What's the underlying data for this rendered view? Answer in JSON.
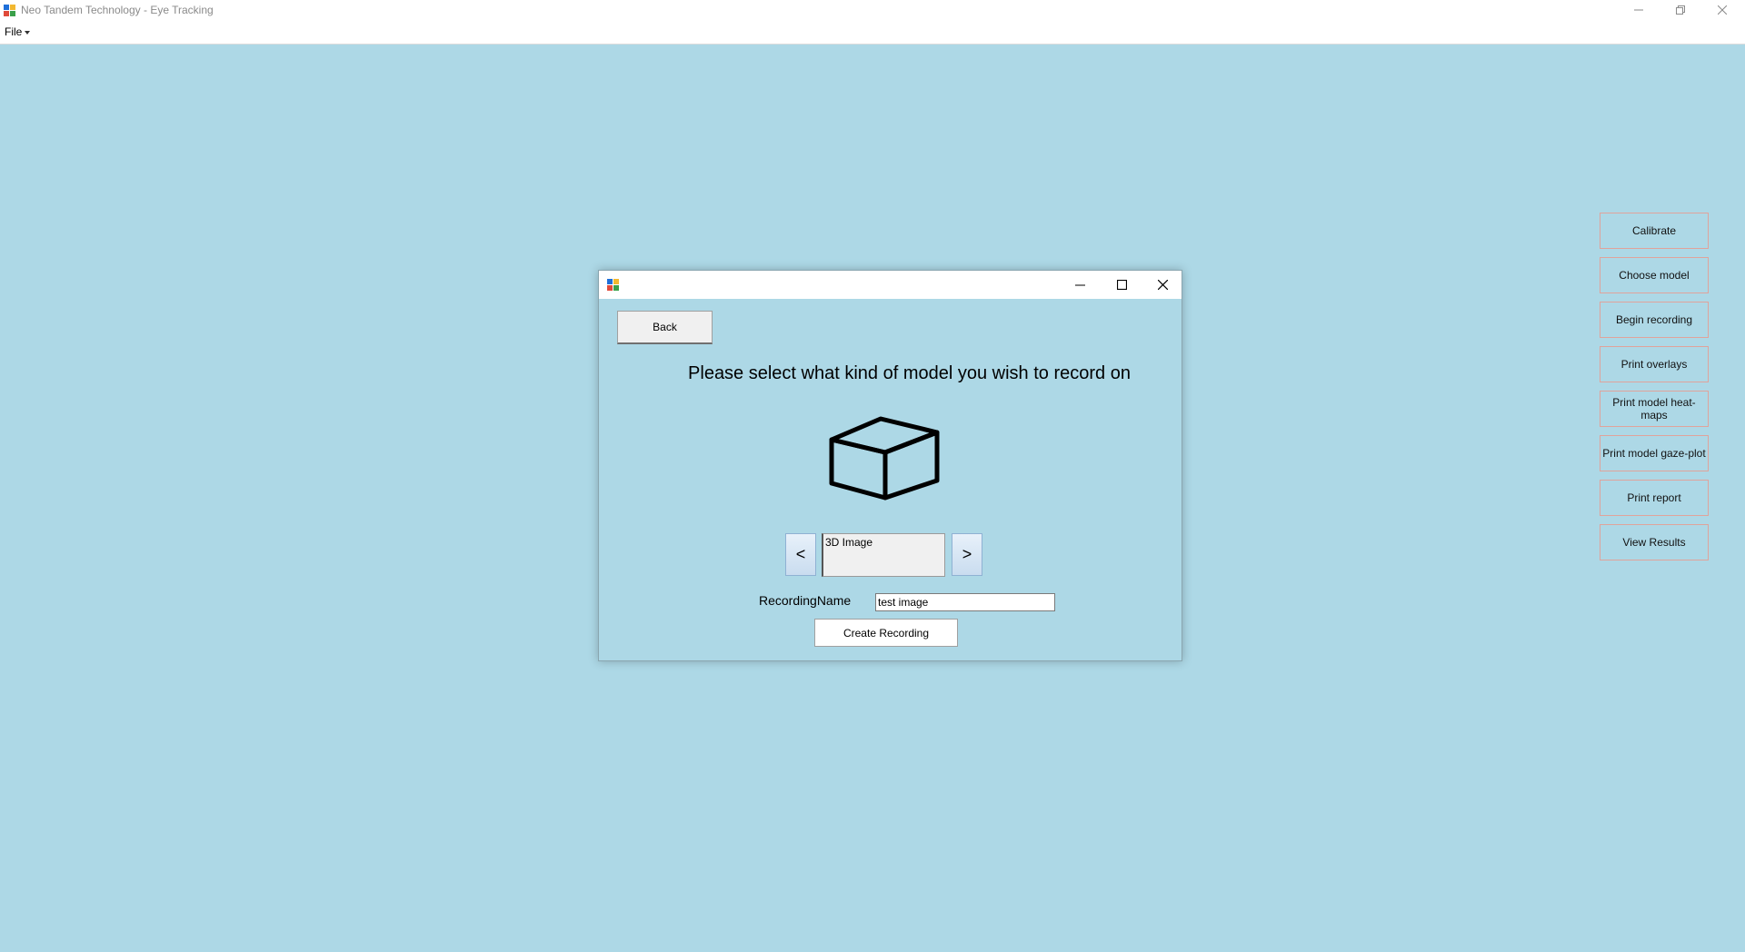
{
  "app": {
    "title": "Neo Tandem Technology - Eye Tracking",
    "menu": {
      "file_label": "File"
    }
  },
  "sidebar": {
    "buttons": [
      {
        "label": "Calibrate"
      },
      {
        "label": "Choose model"
      },
      {
        "label": "Begin recording"
      },
      {
        "label": "Print overlays"
      },
      {
        "label": "Print model heat-maps"
      },
      {
        "label": "Print model gaze-plot"
      },
      {
        "label": "Print report"
      },
      {
        "label": "View Results"
      }
    ]
  },
  "dialog": {
    "back_label": "Back",
    "prompt": "Please select what kind of model you wish to record on",
    "prev_label": "<",
    "next_label": ">",
    "model_type": "3D Image",
    "recording_name_label": "RecordingName",
    "recording_name_value": "test image",
    "create_label": "Create Recording",
    "icon": "cube-icon"
  },
  "colors": {
    "background": "#add8e6",
    "sidebar_border": "#e0a39b"
  }
}
